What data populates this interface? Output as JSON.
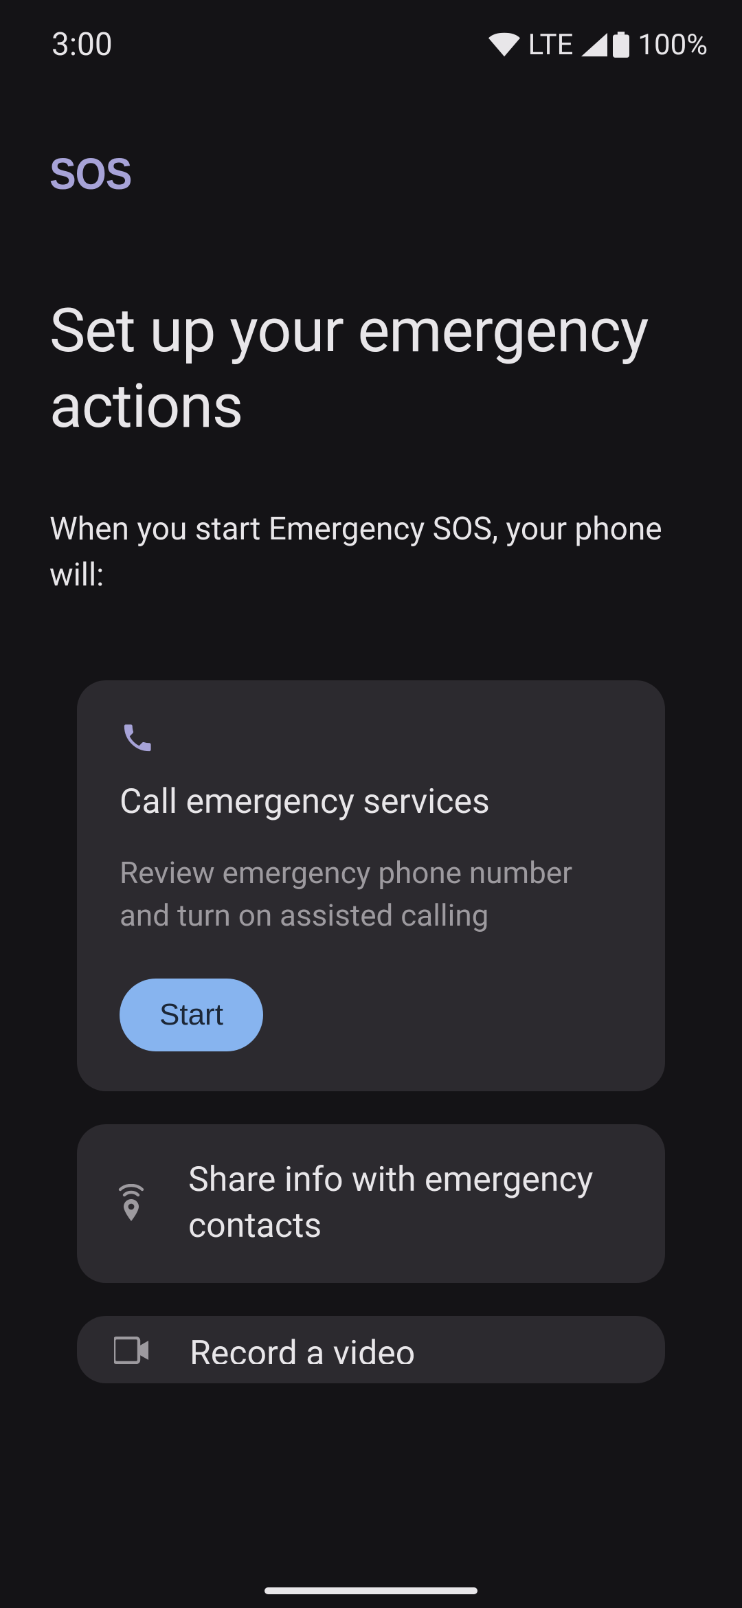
{
  "status": {
    "time": "3:00",
    "lte": "LTE",
    "battery": "100%"
  },
  "header": {
    "sos": "SOS",
    "title": "Set up your emergency actions",
    "subtitle": "When you start Emergency SOS, your phone will:"
  },
  "cards": [
    {
      "title": "Call emergency services",
      "desc": "Review emergency phone number and turn on assisted calling",
      "button": "Start"
    },
    {
      "title": "Share info with emergency contacts"
    },
    {
      "title": "Record a video"
    }
  ]
}
